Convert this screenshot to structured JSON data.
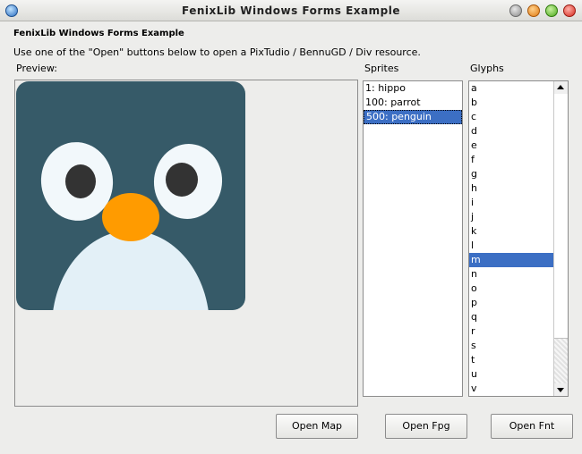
{
  "window": {
    "title": "FenixLib Windows Forms Example"
  },
  "header": {
    "heading": "FenixLib Windows Forms Example",
    "instructions": "Use one of the \"Open\" buttons below to open a PixTudio / BennuGD / Div resource."
  },
  "labels": {
    "preview": "Preview:",
    "sprites": "Sprites",
    "glyphs": "Glyphs"
  },
  "sprites": {
    "items": [
      "1: hippo",
      "100: parrot",
      "500: penguin"
    ],
    "selected_index": 2
  },
  "glyphs": {
    "items": [
      "a",
      "b",
      "c",
      "d",
      "e",
      "f",
      "g",
      "h",
      "i",
      "j",
      "k",
      "l",
      "m",
      "n",
      "o",
      "p",
      "q",
      "r",
      "s",
      "t",
      "u",
      "v"
    ],
    "selected_index": 12
  },
  "buttons": {
    "open_map": "Open Map",
    "open_fpg": "Open Fpg",
    "open_fnt": "Open Fnt"
  },
  "colors": {
    "selection": "#3c6fc4",
    "penguin_background": "#365a68",
    "penguin_beak": "#ff9b00",
    "penguin_belly": "#e3f0f7"
  },
  "icons": {
    "app": "app-icon",
    "window_controls": [
      "minimize-icon",
      "restore-icon",
      "maximize-icon",
      "close-icon"
    ]
  }
}
